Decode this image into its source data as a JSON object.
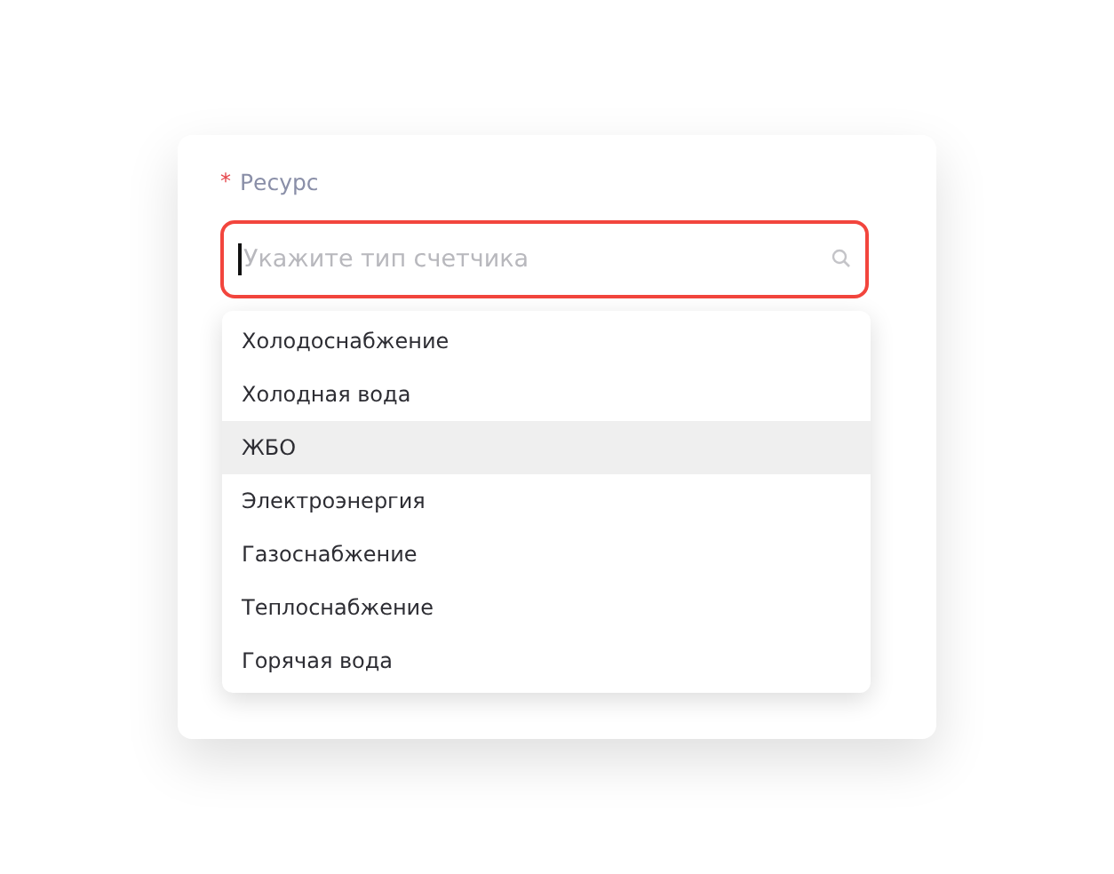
{
  "field": {
    "label": "Ресурс",
    "required_mark": "*",
    "placeholder": "Укажите тип счетчика",
    "error": true
  },
  "options": [
    {
      "label": "Холодоснабжение",
      "selected": false
    },
    {
      "label": "Холодная вода",
      "selected": false
    },
    {
      "label": "ЖБО",
      "selected": true
    },
    {
      "label": "Электроэнергия",
      "selected": false
    },
    {
      "label": "Газоснабжение",
      "selected": false
    },
    {
      "label": "Теплоснабжение",
      "selected": false
    },
    {
      "label": "Горячая вода",
      "selected": false
    }
  ]
}
